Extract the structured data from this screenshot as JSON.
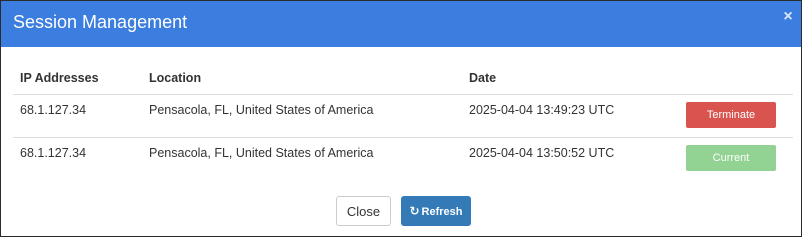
{
  "modal": {
    "title": "Session Management",
    "close_icon_glyph": "×"
  },
  "table": {
    "headers": {
      "ip": "IP Addresses",
      "location": "Location",
      "date": "Date"
    },
    "rows": [
      {
        "ip": "68.1.127.34",
        "location": "Pensacola, FL, United States of America",
        "date": "2025-04-04 13:49:23 UTC",
        "action": "Terminate"
      },
      {
        "ip": "68.1.127.34",
        "location": "Pensacola, FL, United States of America",
        "date": "2025-04-04 13:50:52 UTC",
        "action": "Current"
      }
    ]
  },
  "footer": {
    "close_label": "Close",
    "refresh_label": "Refresh",
    "refresh_icon_glyph": "↻"
  },
  "colors": {
    "header_bg": "#3c7ee0",
    "terminate": "#d9534f",
    "current": "#92d292",
    "refresh": "#337ab7"
  },
  "icons": [
    "close-icon",
    "refresh-icon"
  ]
}
